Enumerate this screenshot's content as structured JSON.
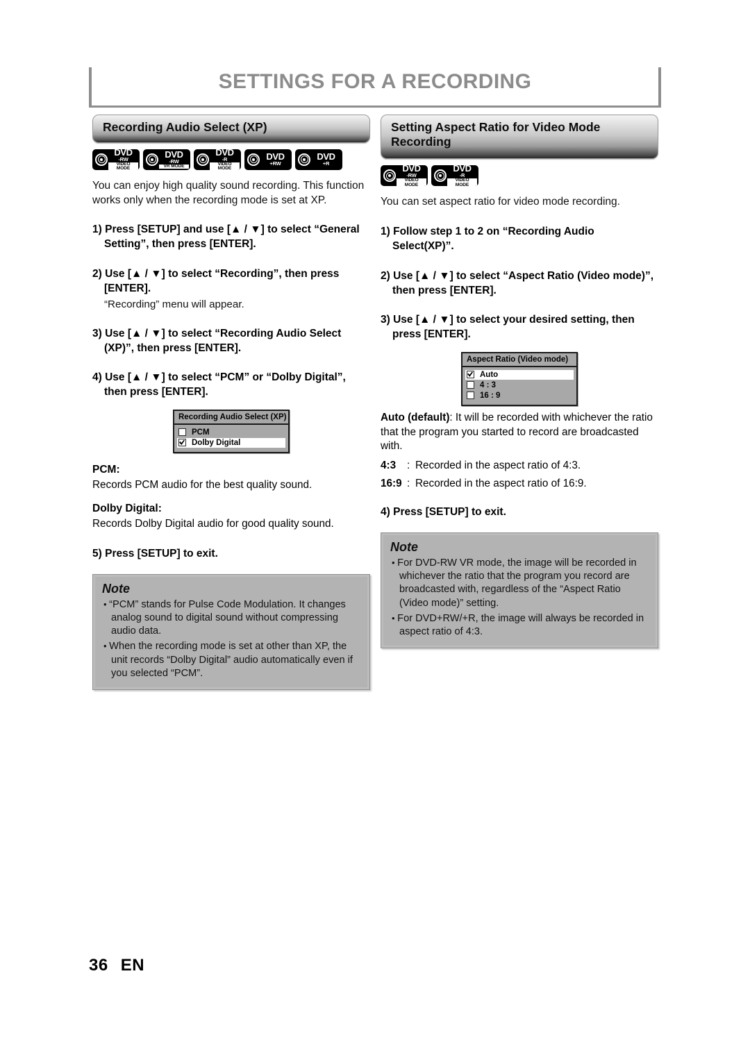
{
  "page": {
    "title": "SETTINGS FOR A RECORDING",
    "footer_page_number": "36",
    "footer_language": "EN"
  },
  "left_column": {
    "section_title": "Recording Audio Select (XP)",
    "media_icons": [
      {
        "name": "dvd-rw-video-mode",
        "word": "DVD",
        "sub": "-RW",
        "banner": "Video Mode"
      },
      {
        "name": "dvd-rw-vr-mode",
        "word": "DVD",
        "sub": "-RW",
        "banner": "VR MODE"
      },
      {
        "name": "dvd-r-video-mode",
        "word": "DVD",
        "sub": "-R",
        "banner": "Video Mode"
      },
      {
        "name": "dvd-plus-rw",
        "word": "DVD",
        "sub": "+RW",
        "banner": ""
      },
      {
        "name": "dvd-plus-r",
        "word": "DVD",
        "sub": "+R",
        "banner": ""
      }
    ],
    "intro": "You can enjoy high quality sound recording. This function works only when the recording mode is set at XP.",
    "steps": [
      {
        "num": "1)",
        "text": "Press [SETUP] and use [▲ / ▼] to select “General Setting”, then press [ENTER]."
      },
      {
        "num": "2)",
        "text": "Use [▲ / ▼] to select “Recording”, then press [ENTER].",
        "sub": "“Recording” menu will appear."
      },
      {
        "num": "3)",
        "text": "Use [▲ / ▼] to select “Recording Audio Select (XP)”, then press [ENTER]."
      },
      {
        "num": "4)",
        "text": "Use [▲ / ▼] to select “PCM” or “Dolby Digital”, then press [ENTER]."
      }
    ],
    "osd": {
      "title": "Recording Audio Select (XP)",
      "options": [
        {
          "label": "PCM",
          "checked": false,
          "selected": false
        },
        {
          "label": "Dolby Digital",
          "checked": true,
          "selected": true
        }
      ]
    },
    "definitions": [
      {
        "term": "PCM:",
        "body": "Records PCM audio for the best quality sound."
      },
      {
        "term": "Dolby Digital:",
        "body": "Records Dolby Digital audio for good quality sound."
      }
    ],
    "final_step": {
      "num": "5)",
      "text": "Press [SETUP] to exit."
    },
    "note": {
      "title": "Note",
      "items": [
        "“PCM” stands for Pulse Code Modulation. It changes analog sound to digital sound without compressing audio data.",
        "When the recording mode is set at other than XP, the unit records “Dolby Digital” audio automatically even if you selected “PCM”."
      ]
    }
  },
  "right_column": {
    "section_title": "Setting Aspect Ratio for Video Mode Recording",
    "media_icons": [
      {
        "name": "dvd-rw-video-mode",
        "word": "DVD",
        "sub": "-RW",
        "banner": "Video Mode"
      },
      {
        "name": "dvd-r-video-mode",
        "word": "DVD",
        "sub": "-R",
        "banner": "Video Mode"
      }
    ],
    "intro": "You can set aspect ratio for video mode recording.",
    "steps": [
      {
        "num": "1)",
        "text": "Follow step 1 to 2 on “Recording Audio Select(XP)”."
      },
      {
        "num": "2)",
        "text": "Use [▲ / ▼] to select “Aspect Ratio (Video mode)”, then press [ENTER]."
      },
      {
        "num": "3)",
        "text": "Use [▲ / ▼] to select your desired setting, then press [ENTER]."
      }
    ],
    "osd": {
      "title": "Aspect Ratio (Video mode)",
      "options": [
        {
          "label": "Auto",
          "checked": true,
          "selected": true
        },
        {
          "label": "4 : 3",
          "checked": false,
          "selected": false
        },
        {
          "label": "16 : 9",
          "checked": false,
          "selected": false
        }
      ]
    },
    "auto_desc_bold": "Auto (default)",
    "auto_desc_rest": ": It will be recorded with whichever the ratio that the program you started to record are broadcasted with.",
    "ratio_lines": [
      {
        "label": "4:3",
        "sep": ":",
        "text": "Recorded in the aspect ratio of 4:3."
      },
      {
        "label": "16:9",
        "sep": ":",
        "text": "Recorded in the aspect ratio of 16:9."
      }
    ],
    "final_step": {
      "num": "4)",
      "text": "Press [SETUP] to exit."
    },
    "note": {
      "title": "Note",
      "items": [
        "For DVD-RW VR mode, the image will be recorded in whichever the ratio that the program you record are broadcasted with, regardless of the “Aspect Ratio (Video mode)” setting.",
        "For DVD+RW/+R, the image will always be recorded in aspect ratio of 4:3."
      ]
    }
  }
}
